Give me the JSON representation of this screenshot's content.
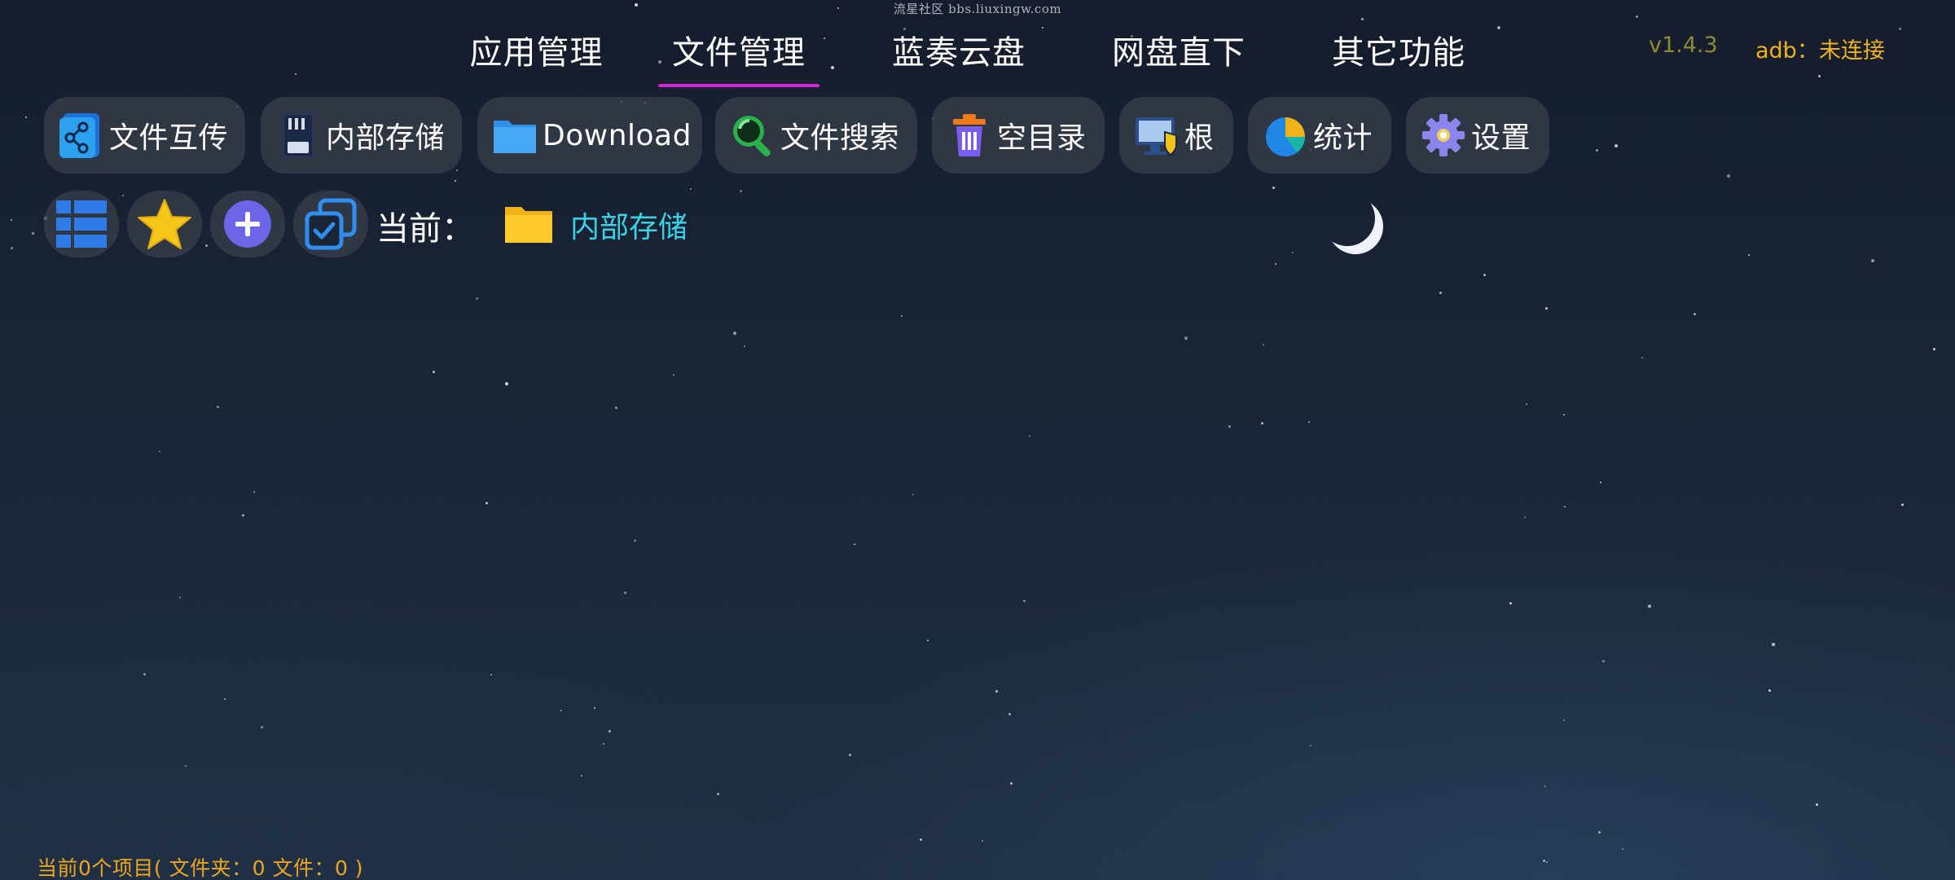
{
  "watermark": "流星社区 bbs.liuxingw.com",
  "tabs": [
    {
      "label": "应用管理",
      "active": false
    },
    {
      "label": "文件管理",
      "active": true
    },
    {
      "label": "蓝奏云盘",
      "active": false
    },
    {
      "label": "网盘直下",
      "active": false
    },
    {
      "label": "其它功能",
      "active": false
    }
  ],
  "version": "v1.4.3",
  "adb_status": "adb：未连接",
  "toolbar": [
    {
      "label": "文件互传",
      "icon": "share-icon"
    },
    {
      "label": "内部存储",
      "icon": "sd-card-icon"
    },
    {
      "label": "Download",
      "icon": "folder-icon"
    },
    {
      "label": "文件搜索",
      "icon": "search-icon"
    },
    {
      "label": "空目录",
      "icon": "trash-icon"
    },
    {
      "label": "根",
      "icon": "root-monitor-icon"
    },
    {
      "label": "统计",
      "icon": "pie-chart-icon"
    },
    {
      "label": "设置",
      "icon": "gear-icon"
    }
  ],
  "actions": [
    {
      "icon": "list-view-icon"
    },
    {
      "icon": "star-icon"
    },
    {
      "icon": "add-icon"
    },
    {
      "icon": "multi-select-icon"
    }
  ],
  "current": {
    "label": "当前：",
    "path": "内部存储"
  },
  "status": "当前0个项目( 文件夹：0   文件：0 )",
  "colors": {
    "accent_underline": "#d524d8",
    "path_color": "#3ad1e6",
    "status_color": "#f0a51a",
    "version_color": "#8d8a36",
    "adb_color": "#f0b21a"
  }
}
